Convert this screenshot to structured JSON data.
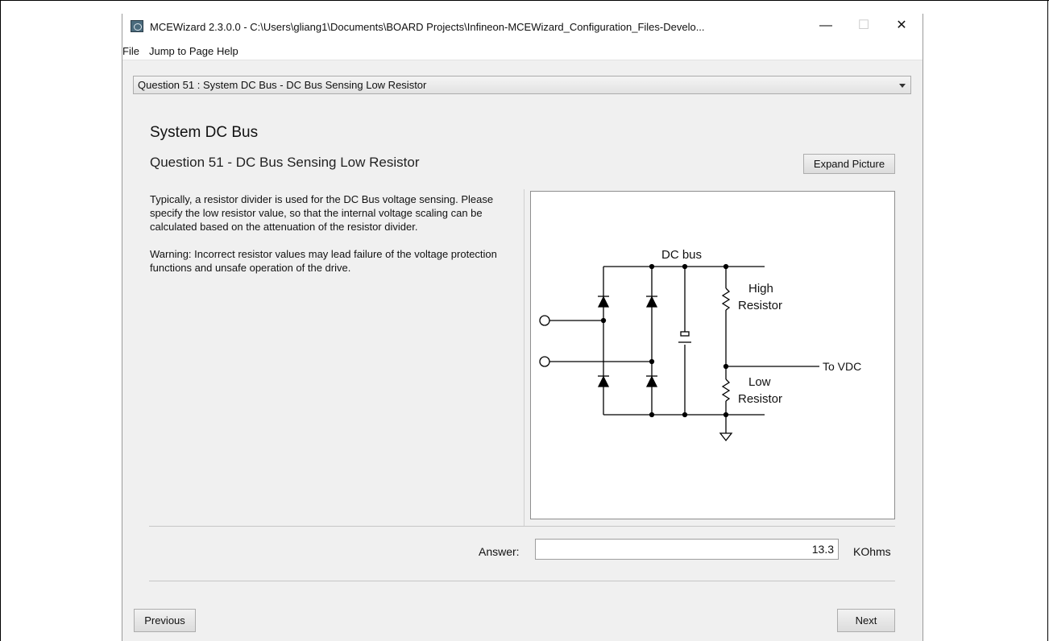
{
  "window": {
    "title": "MCEWizard 2.3.0.0  - C:\\Users\\gliang1\\Documents\\BOARD Projects\\Infineon-MCEWizard_Configuration_Files-Develo...",
    "minimize": "—",
    "maximize": "☐",
    "close": "✕"
  },
  "menu": {
    "items": [
      "File",
      "Jump to Page",
      "Help"
    ]
  },
  "question_selector": {
    "value": "Question  51 : System DC Bus - DC Bus Sensing Low Resistor"
  },
  "page": {
    "section_title": "System DC Bus",
    "question_title": "Question 51  -  DC Bus Sensing Low Resistor",
    "expand_button": "Expand Picture",
    "description": [
      "Typically, a resistor divider is used for the DC Bus voltage sensing. Please specify the low resistor value, so that the internal voltage scaling can be calculated based on the attenuation of the resistor divider.",
      "Warning: Incorrect resistor values may lead failure of the voltage protection functions and unsafe operation of the drive."
    ]
  },
  "diagram": {
    "dc_bus": "DC bus",
    "high_resistor_1": "High",
    "high_resistor_2": "Resistor",
    "low_resistor_1": "Low",
    "low_resistor_2": "Resistor",
    "to_vdc": "To VDC"
  },
  "answer": {
    "label": "Answer:",
    "value": "13.3",
    "unit": "KOhms"
  },
  "nav": {
    "previous": "Previous",
    "next": "Next"
  }
}
